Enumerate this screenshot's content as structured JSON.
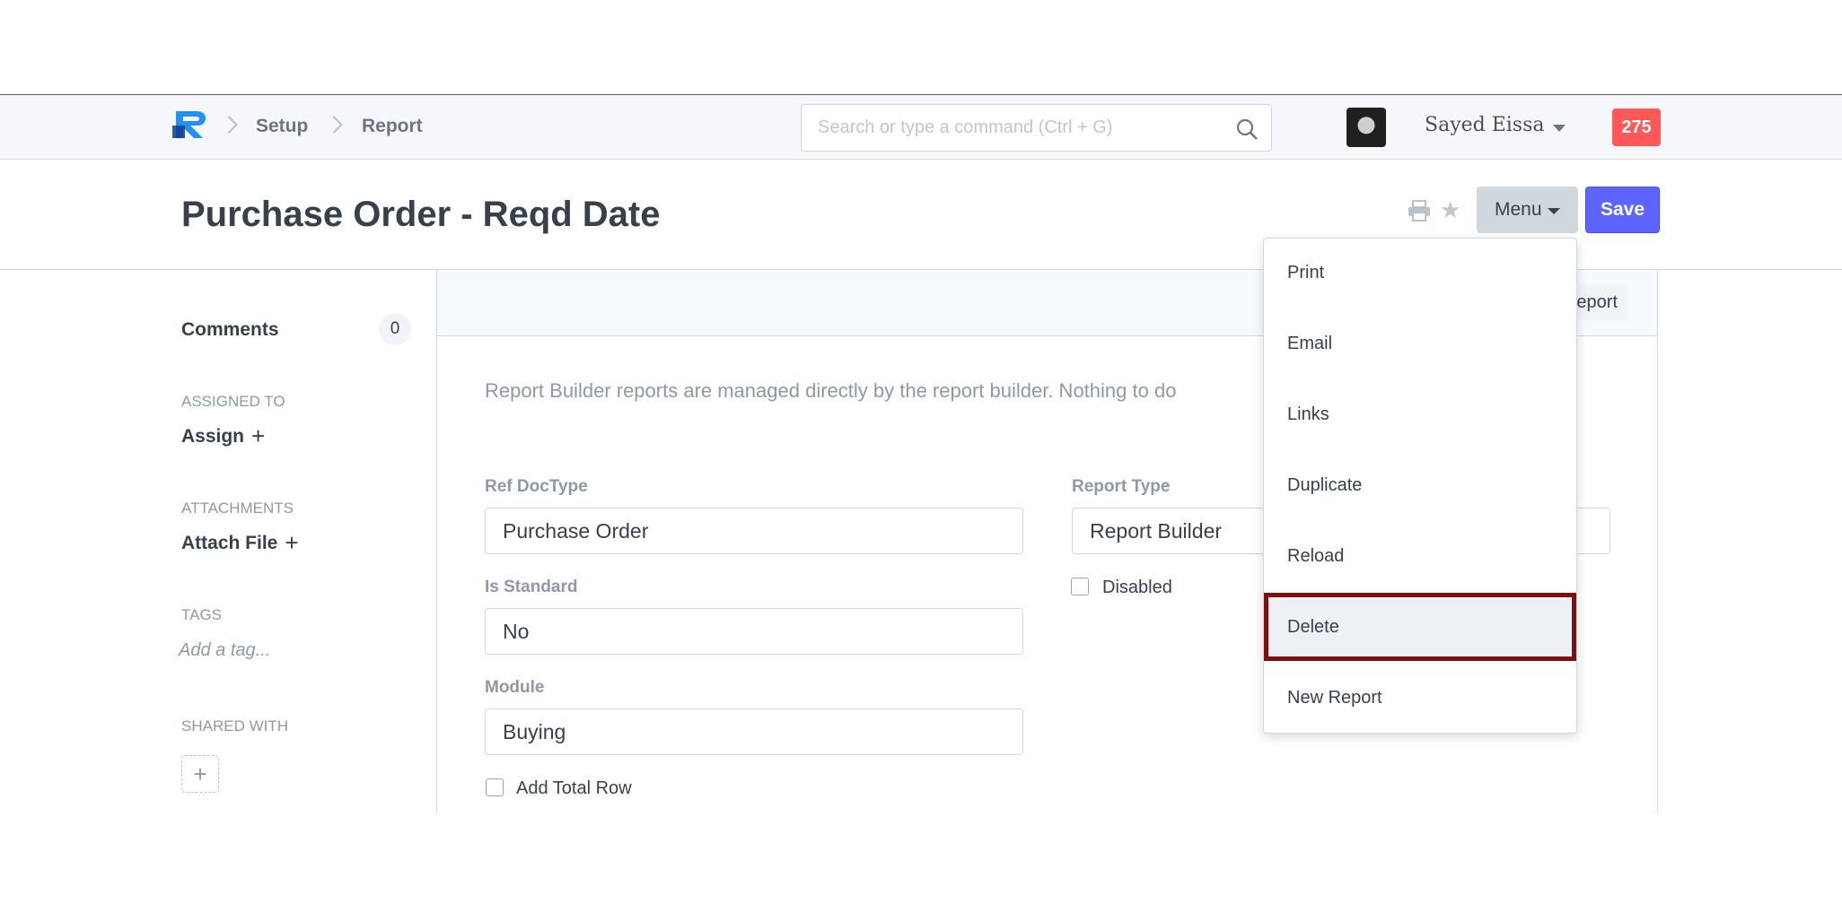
{
  "navbar": {
    "breadcrumbs": [
      "Setup",
      "Report"
    ],
    "search_placeholder": "Search or type a command (Ctrl + G)",
    "user_name": "Sayed Eissa",
    "notification_count": "275"
  },
  "page": {
    "title": "Purchase Order - Reqd Date",
    "menu_label": "Menu",
    "save_label": "Save"
  },
  "sidebar": {
    "comments_label": "Comments",
    "comments_count": "0",
    "assigned_to_label": "ASSIGNED TO",
    "assign_label": "Assign",
    "attachments_label": "ATTACHMENTS",
    "attach_file_label": "Attach File",
    "tags_label": "TAGS",
    "tag_placeholder": "Add a tag...",
    "shared_with_label": "SHARED WITH"
  },
  "form": {
    "head_button": "Report",
    "intro": "Report Builder reports are managed directly by the report builder. Nothing to do",
    "ref_doctype_label": "Ref DocType",
    "ref_doctype_value": "Purchase Order",
    "report_type_label": "Report Type",
    "report_type_value": "Report Builder",
    "is_standard_label": "Is Standard",
    "is_standard_value": "No",
    "module_label": "Module",
    "module_value": "Buying",
    "disabled_label": "Disabled",
    "add_total_row_label": "Add Total Row"
  },
  "menu_dropdown": {
    "items": [
      "Print",
      "Email",
      "Links",
      "Duplicate",
      "Reload",
      "Delete",
      "New Report"
    ],
    "highlighted": "Delete"
  },
  "colors": {
    "primary": "#5e64ff",
    "notification": "#ff5858",
    "highlight_border": "#7a1010"
  }
}
